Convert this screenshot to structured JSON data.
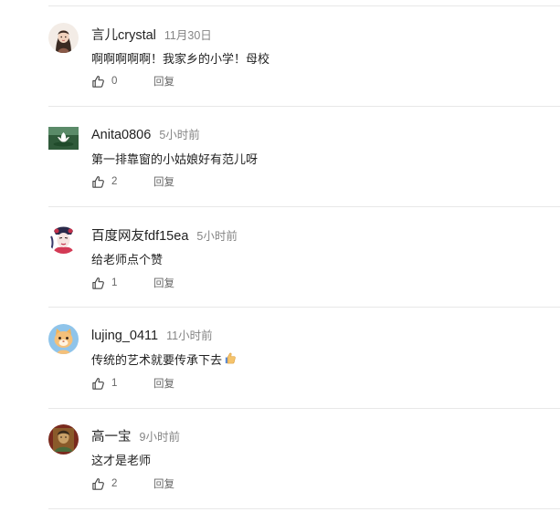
{
  "comments": [
    {
      "username": "言儿crystal",
      "time": "11月30日",
      "content": "啊啊啊啊啊！我家乡的小学！母校",
      "like_count": "0",
      "reply_label": "回复",
      "avatar_icon": "girl-illustration-avatar"
    },
    {
      "username": "Anita0806",
      "time": "5小时前",
      "content": "第一排靠窗的小姑娘好有范儿呀",
      "like_count": "2",
      "reply_label": "回复",
      "avatar_icon": "lotus-flower-avatar"
    },
    {
      "username": "百度网友fdf15ea",
      "time": "5小时前",
      "content": "给老师点个赞",
      "like_count": "1",
      "reply_label": "回复",
      "avatar_icon": "opera-mask-avatar"
    },
    {
      "username": "lujing_0411",
      "time": "11小时前",
      "content": "传统的艺术就要传承下去",
      "like_count": "1",
      "reply_label": "回复",
      "avatar_icon": "cartoon-cat-avatar"
    },
    {
      "username": "高一宝",
      "time": "9小时前",
      "content": "这才是老师",
      "like_count": "2",
      "reply_label": "回复",
      "avatar_icon": "portrait-photo-avatar"
    }
  ],
  "icons": {
    "like": "thumbs-up-outline-icon",
    "content_emoji": "thumbs-up-emoji"
  },
  "colors": {
    "username": "#222222",
    "time": "#858585",
    "action_text": "#666666",
    "divider": "#e8e8e8"
  }
}
